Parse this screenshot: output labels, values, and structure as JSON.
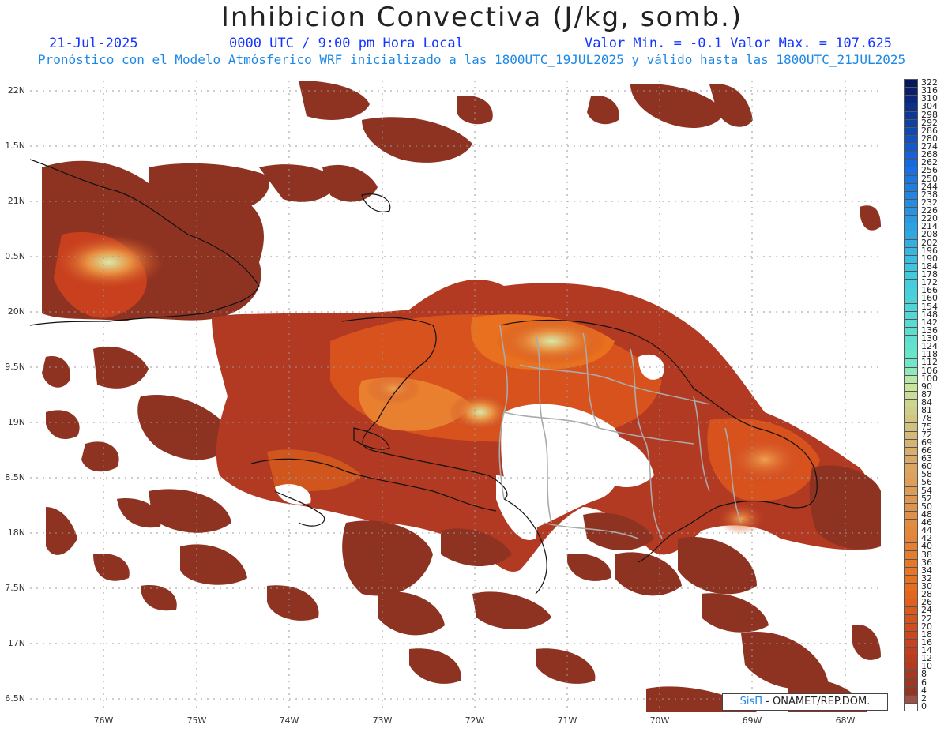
{
  "header": {
    "title": "Inhibicion Convectiva (J/kg, somb.)",
    "date": "21-Jul-2025",
    "time": "0000 UTC / 9:00 pm Hora Local",
    "minmax": "Valor Min. = -0.1  Valor Max. = 107.625",
    "subtitle": "Pronóstico con el Modelo Atmósferico WRF inicializado a las 1800UTC_19JUL2025 y válido hasta las  1800UTC_21JUL2025"
  },
  "axes": {
    "lat_labels": [
      "22N",
      "1.5N",
      "21N",
      "0.5N",
      "20N",
      "9.5N",
      "19N",
      "8.5N",
      "18N",
      "7.5N",
      "17N",
      "6.5N"
    ],
    "lon_labels": [
      "76W",
      "75W",
      "74W",
      "73W",
      "72W",
      "71W",
      "70W",
      "69W",
      "68W"
    ]
  },
  "legend": {
    "labels": [
      "322",
      "316",
      "310",
      "304",
      "298",
      "292",
      "286",
      "280",
      "274",
      "268",
      "262",
      "256",
      "250",
      "244",
      "238",
      "232",
      "226",
      "220",
      "214",
      "208",
      "202",
      "196",
      "190",
      "184",
      "178",
      "172",
      "166",
      "160",
      "154",
      "148",
      "142",
      "136",
      "130",
      "124",
      "118",
      "112",
      "106",
      "100",
      "90",
      "87",
      "84",
      "81",
      "78",
      "75",
      "72",
      "69",
      "66",
      "63",
      "60",
      "58",
      "56",
      "54",
      "52",
      "50",
      "48",
      "46",
      "44",
      "42",
      "40",
      "38",
      "36",
      "34",
      "32",
      "30",
      "28",
      "26",
      "24",
      "22",
      "20",
      "18",
      "16",
      "14",
      "12",
      "10",
      "8",
      "6",
      "4",
      "2",
      "0"
    ],
    "colors": {
      "navy": "#08155e",
      "blue": "#1565e0",
      "cyan": "#3ec7e0",
      "aqua": "#6ee8c8",
      "pale": "#c8e8a0",
      "tan": "#d8b070",
      "orange": "#e8701e",
      "red": "#c8401e",
      "brown": "#8e3322",
      "white": "#ffffff"
    }
  },
  "credit": {
    "sis": "SisΠ",
    "text": "- ONAMET/REP.DOM."
  }
}
